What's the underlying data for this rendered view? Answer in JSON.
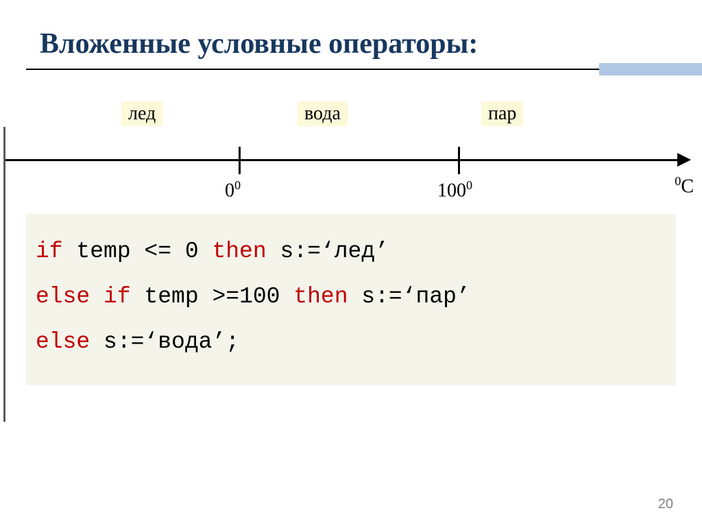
{
  "title": "Вложенные условные операторы:",
  "states": {
    "ice": "лед",
    "water": "вода",
    "steam": "пар"
  },
  "numberline": {
    "tick1_label_base": "0",
    "tick1_label_sup": "0",
    "tick2_label_base": "100",
    "tick2_label_sup": "0",
    "axis_sup": "0",
    "axis_base": "С"
  },
  "code": {
    "kw_if1": "if",
    "seg1": " temp <= 0 ",
    "kw_then1": "then",
    "seg2": " s:=‘лед’",
    "indent2": " ",
    "kw_else1": "else",
    "seg3": " ",
    "kw_if2": "if",
    "seg4": " temp >=100 ",
    "kw_then2": "then",
    "seg5": " s:=‘пар’",
    "indent3": "  ",
    "kw_else2": "else",
    "seg6": " s:=‘вода’;"
  },
  "page_number": "20"
}
